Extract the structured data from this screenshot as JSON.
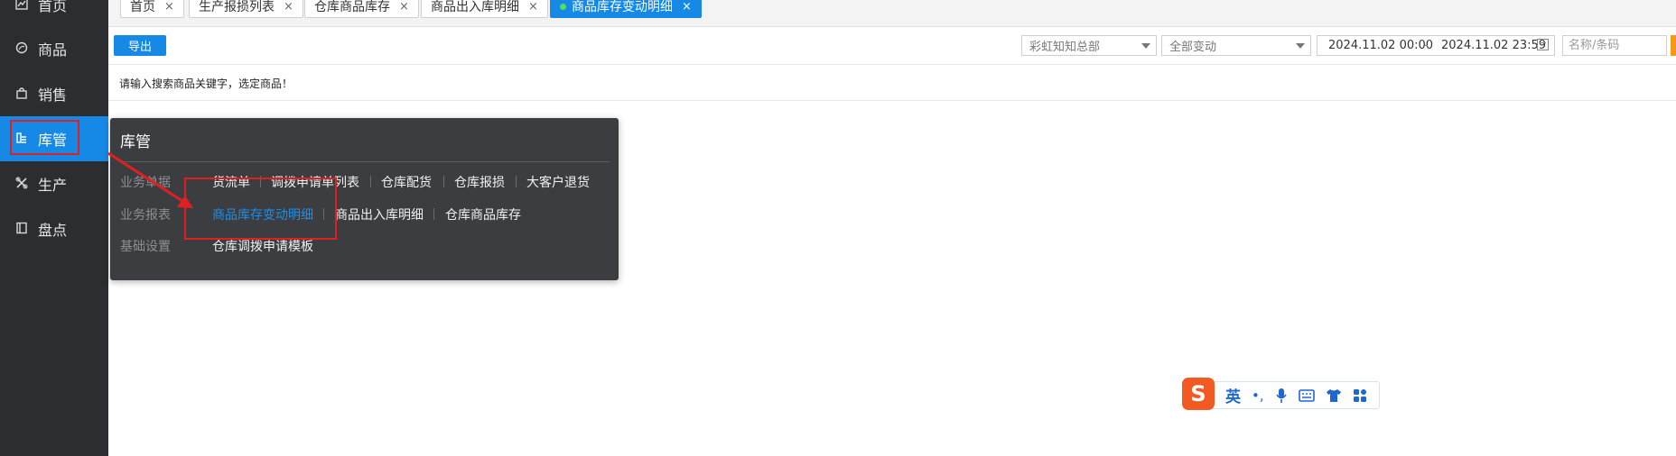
{
  "sidebar": {
    "items": [
      {
        "label": "首页",
        "icon": "chart-icon"
      },
      {
        "label": "商品",
        "icon": "circle-icon"
      },
      {
        "label": "销售",
        "icon": "bag-icon"
      },
      {
        "label": "库管",
        "icon": "warehouse-icon"
      },
      {
        "label": "生产",
        "icon": "tools-icon"
      },
      {
        "label": "盘点",
        "icon": "book-icon"
      }
    ]
  },
  "tabs": [
    {
      "label": "首页",
      "close": "×"
    },
    {
      "label": "生产报损列表",
      "close": "×"
    },
    {
      "label": "仓库商品库存",
      "close": "×"
    },
    {
      "label": "商品出入库明细",
      "close": "×"
    },
    {
      "label": "商品库存变动明细",
      "close": "×"
    }
  ],
  "toolbar": {
    "export_label": "导出",
    "org_select": "彩虹知知总部",
    "change_select": "全部变动",
    "date_start": "2024.11.02 00:00",
    "date_sep": "-",
    "date_end": "2024.11.02 23:59",
    "search_placeholder": "名称/条码"
  },
  "hint": "请输入搜索商品关键字，选定商品！",
  "popup": {
    "title": "库管",
    "rows": [
      {
        "label": "业务单据",
        "links": [
          "货流单",
          "调拨申请单列表",
          "仓库配货",
          "仓库报损",
          "大客户退货"
        ]
      },
      {
        "label": "业务报表",
        "links": [
          "商品库存变动明细",
          "商品出入库明细",
          "仓库商品库存"
        ]
      },
      {
        "label": "基础设置",
        "links": [
          "仓库调拨申请模板"
        ]
      }
    ]
  },
  "ime": {
    "logo": "S",
    "lang": "英",
    "punct": "•,",
    "icons": [
      "microphone-icon",
      "keyboard-icon",
      "shirt-icon",
      "apps-icon"
    ]
  },
  "colors": {
    "sidebar_bg": "#2b2d30",
    "accent": "#1589e5",
    "popup_bg": "#3c3d40",
    "annotation_red": "#e02020"
  }
}
